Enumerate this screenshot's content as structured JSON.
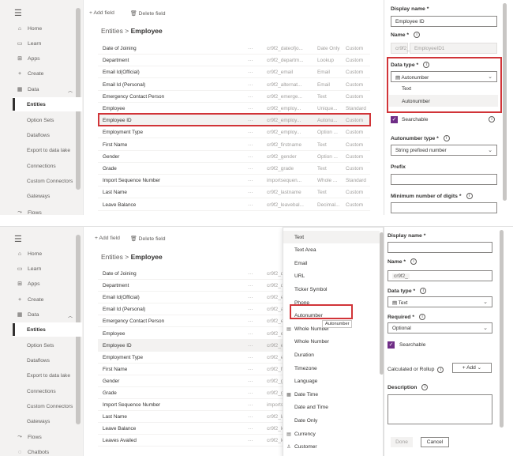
{
  "nav": {
    "home": "Home",
    "learn": "Learn",
    "apps": "Apps",
    "create": "Create",
    "data": "Data",
    "entities": "Entities",
    "option_sets": "Option Sets",
    "dataflows": "Dataflows",
    "export": "Export to data lake",
    "connections": "Connections",
    "custom_connectors": "Custom Connectors",
    "gateways": "Gateways",
    "flows": "Flows",
    "chatbots": "Chatbots"
  },
  "toolbar": {
    "add_field": "Add field",
    "delete_field": "Delete field"
  },
  "breadcrumb": {
    "root": "Entities",
    "sep": ">",
    "current": "Employee"
  },
  "top_rows": [
    {
      "name": "Date of Joining",
      "dots": "···",
      "id": "cr9f2_dateofjo...",
      "type": "Date Only",
      "custom": "Custom"
    },
    {
      "name": "Department",
      "dots": "···",
      "id": "cr9f2_departm...",
      "type": "Lookup",
      "custom": "Custom"
    },
    {
      "name": "Email Id(Official)",
      "dots": "···",
      "id": "cr9f2_email",
      "type": "Email",
      "custom": "Custom"
    },
    {
      "name": "Email Id (Personal)",
      "dots": "···",
      "id": "cr9f2_alternat...",
      "type": "Email",
      "custom": "Custom"
    },
    {
      "name": "Emergency Contact Person",
      "dots": "···",
      "id": "cr9f2_emerge...",
      "type": "Text",
      "custom": "Custom"
    },
    {
      "name": "Employee",
      "dots": "···",
      "id": "cr9f2_employ...",
      "type": "Unique...",
      "custom": "Standard"
    },
    {
      "name": "Employee ID",
      "dots": "···",
      "id": "cr9f2_employ...",
      "type": "Autonu...",
      "custom": "Custom"
    },
    {
      "name": "Employment Type",
      "dots": "···",
      "id": "cr9f2_employ...",
      "type": "Option ...",
      "custom": "Custom"
    },
    {
      "name": "First Name",
      "dots": "···",
      "id": "cr9f2_firstname",
      "type": "Text",
      "custom": "Custom"
    },
    {
      "name": "Gender",
      "dots": "···",
      "id": "cr9f2_gender",
      "type": "Option ...",
      "custom": "Custom"
    },
    {
      "name": "Grade",
      "dots": "···",
      "id": "cr9f2_grade",
      "type": "Text",
      "custom": "Custom"
    },
    {
      "name": "Import Sequence Number",
      "dots": "···",
      "id": "importsequen...",
      "type": "Whole ...",
      "custom": "Standard"
    },
    {
      "name": "Last Name",
      "dots": "···",
      "id": "cr9f2_lastname",
      "type": "Text",
      "custom": "Custom"
    },
    {
      "name": "Leave Balance",
      "dots": "···",
      "id": "cr9f2_leavebal...",
      "type": "Decimal...",
      "custom": "Custom"
    }
  ],
  "bottom_rows": [
    {
      "name": "Date of Joining",
      "dots": "···",
      "id": "cr9f2_da"
    },
    {
      "name": "Department",
      "dots": "···",
      "id": "cr9f2_de"
    },
    {
      "name": "Email Id(Official)",
      "dots": "···",
      "id": "cr9f2_er"
    },
    {
      "name": "Email Id (Personal)",
      "dots": "···",
      "id": "cr9f2_al"
    },
    {
      "name": "Emergency Contact Person",
      "dots": "···",
      "id": "cr9f2_er"
    },
    {
      "name": "Employee",
      "dots": "···",
      "id": "cr9f2_er"
    },
    {
      "name": "Employee ID",
      "dots": "···",
      "id": "cr9f2_er"
    },
    {
      "name": "Employment Type",
      "dots": "···",
      "id": "cr9f2_er"
    },
    {
      "name": "First Name",
      "dots": "···",
      "id": "cr9f2_fir"
    },
    {
      "name": "Gender",
      "dots": "···",
      "id": "cr9f2_ge"
    },
    {
      "name": "Grade",
      "dots": "···",
      "id": "cr9f2_gr"
    },
    {
      "name": "Import Sequence Number",
      "dots": "···",
      "id": "importse"
    },
    {
      "name": "Last Name",
      "dots": "···",
      "id": "cr9f2_la"
    },
    {
      "name": "Leave Balance",
      "dots": "···",
      "id": "cr9f2_le"
    },
    {
      "name": "Leaves Availed",
      "dots": "···",
      "id": "cr9f2_le"
    }
  ],
  "top_panel": {
    "display_name_label": "Display name *",
    "display_name_value": "Employee ID",
    "name_label": "Name *",
    "name_prefix": "cr9f2_",
    "name_value": "EmployeeID1",
    "data_type_label": "Data type *",
    "data_type_value": "Autonumber",
    "options": [
      "Text",
      "Autonumber"
    ],
    "searchable": "Searchable",
    "autonumber_type_label": "Autonumber type *",
    "autonumber_type_value": "String prefixed number",
    "prefix_label": "Prefix",
    "min_digits_label": "Minimum number of digits *"
  },
  "bottom_panel": {
    "display_name_label": "Display name *",
    "name_label": "Name *",
    "name_prefix": "cr9f2_",
    "data_type_label": "Data type *",
    "data_type_value": "Text",
    "required_label": "Required *",
    "required_value": "Optional",
    "searchable": "Searchable",
    "calc_label": "Calculated or Rollup",
    "add_label": "Add",
    "description_label": "Description",
    "done": "Done",
    "cancel": "Cancel"
  },
  "type_list": [
    {
      "label": "Text",
      "icon": ""
    },
    {
      "label": "Text Area",
      "icon": ""
    },
    {
      "label": "Email",
      "icon": ""
    },
    {
      "label": "URL",
      "icon": ""
    },
    {
      "label": "Ticker Symbol",
      "icon": ""
    },
    {
      "label": "Phone",
      "icon": ""
    },
    {
      "label": "Autonumber",
      "icon": ""
    },
    {
      "label": "Whole Number",
      "icon": "▤"
    },
    {
      "label": "Whole Number",
      "icon": ""
    },
    {
      "label": "Duration",
      "icon": ""
    },
    {
      "label": "Timezone",
      "icon": ""
    },
    {
      "label": "Language",
      "icon": ""
    },
    {
      "label": "Date Time",
      "icon": "▦"
    },
    {
      "label": "Date and Time",
      "icon": ""
    },
    {
      "label": "Date Only",
      "icon": ""
    },
    {
      "label": "Currency",
      "icon": "▤"
    },
    {
      "label": "Customer",
      "icon": "♙"
    }
  ],
  "tooltip": "Autonumber",
  "colors": {
    "accent_red": "#d13438",
    "checkbox": "#6f2d86"
  }
}
